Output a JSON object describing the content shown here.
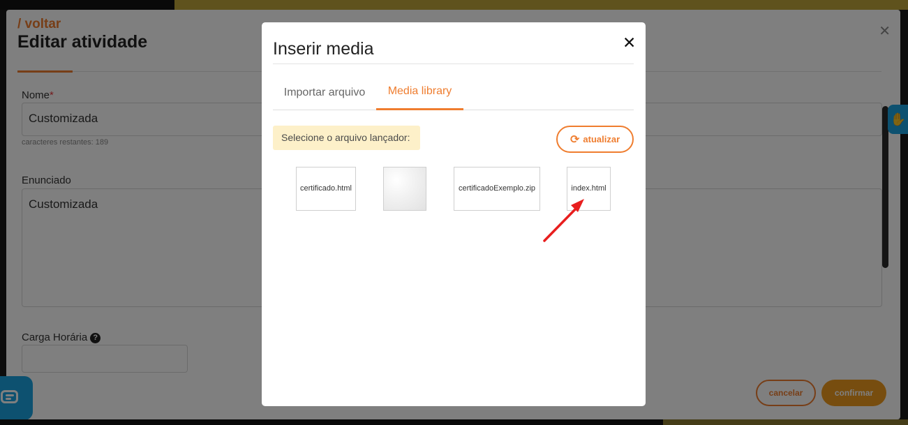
{
  "background": {
    "back_link": "/ voltar",
    "title": "Editar atividade",
    "close_glyph": "✕",
    "fields": {
      "name_label": "Nome",
      "required_mark": "*",
      "name_value": "Customizada",
      "chars_remaining": "caracteres restantes: 189",
      "statement_label": "Enunciado",
      "statement_value": "Customizada",
      "workload_label": "Carga Horária",
      "help_glyph": "?"
    },
    "buttons": {
      "cancel": "cancelar",
      "confirm": "confirmar"
    },
    "accessibility_widget_icon": "hand-icon",
    "chat_widget_icon": "chat-icon"
  },
  "modal": {
    "title": "Inserir media",
    "close_glyph": "✕",
    "tabs": [
      {
        "label": "Importar arquivo",
        "active": false
      },
      {
        "label": "Media library",
        "active": true
      }
    ],
    "notice": "Selecione o arquivo lançador:",
    "refresh": {
      "label": "atualizar",
      "icon": "refresh-icon",
      "glyph": "⟳"
    },
    "files": [
      {
        "name": "certificado.html",
        "type": "file"
      },
      {
        "name": "",
        "type": "image-thumbnail"
      },
      {
        "name": "certificadoExemplo.zip",
        "type": "file"
      },
      {
        "name": "index.html",
        "type": "file",
        "highlighted": true
      }
    ]
  },
  "colors": {
    "accent": "#ef7d2f",
    "confirm": "#ef9a1f",
    "notice_bg": "#fdf0c9",
    "annotation_arrow": "#e81e1e",
    "widget_blue": "#1aa3e0"
  }
}
